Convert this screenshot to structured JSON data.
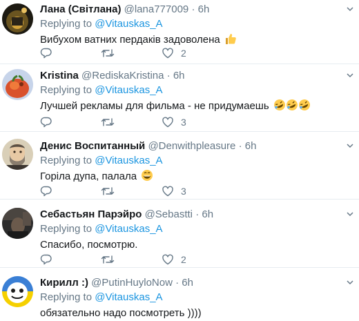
{
  "tweets": [
    {
      "name": "Лана (Світлана)",
      "handle": "@lana777009",
      "dot": "·",
      "time": "6h",
      "replying_prefix": "Replying to ",
      "replying_to": "@Vitauskas_A",
      "text": "Вибухом ватних пердаків задоволена",
      "emoji": "thumbs-up",
      "reply_count": "",
      "retweet_count": "",
      "like_count": "2"
    },
    {
      "name": "Kristina",
      "handle": "@RediskaKristina",
      "dot": "·",
      "time": "6h",
      "replying_prefix": "Replying to ",
      "replying_to": "@Vitauskas_A",
      "text": "Лучшей рекламы для фильма - не придумаешь",
      "emoji": "rolling-laughing x3",
      "reply_count": "",
      "retweet_count": "",
      "like_count": "3"
    },
    {
      "name": "Денис Воспитанный",
      "handle": "@Denwithpleasure",
      "dot": "·",
      "time": "6h",
      "replying_prefix": "Replying to ",
      "replying_to": "@Vitauskas_A",
      "text": "Горіла дупа, палала",
      "emoji": "grinning-face",
      "reply_count": "",
      "retweet_count": "",
      "like_count": "3"
    },
    {
      "name": "Себастьян Парэйро",
      "handle": "@Sebastti",
      "dot": "·",
      "time": "6h",
      "replying_prefix": "Replying to ",
      "replying_to": "@Vitauskas_A",
      "text": "Спасибо, посмотрю.",
      "emoji": "",
      "reply_count": "",
      "retweet_count": "",
      "like_count": "2"
    },
    {
      "name": "Кирилл :)",
      "handle": "@PutinHuyloNow",
      "dot": "·",
      "time": "6h",
      "replying_prefix": "Replying to ",
      "replying_to": "@Vitauskas_A",
      "text": "обязательно надо посмотреть ))))",
      "emoji": "",
      "reply_count": "",
      "retweet_count": "",
      "like_count": ""
    }
  ],
  "colors": {
    "text": "#14171a",
    "muted": "#657786",
    "link": "#1b95e0",
    "divider": "#e6ecf0"
  },
  "icons": [
    "reply-icon",
    "retweet-icon",
    "like-icon",
    "caret-down-icon"
  ]
}
